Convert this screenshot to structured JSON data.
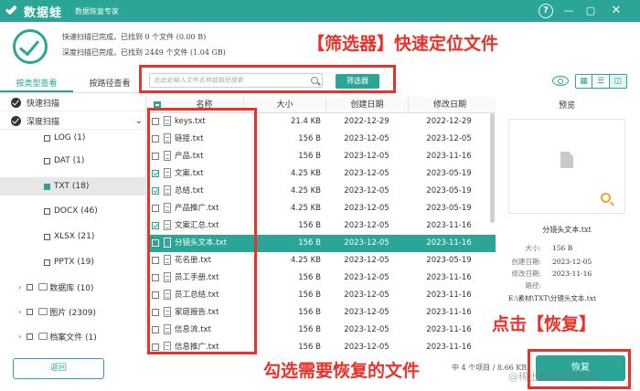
{
  "app": {
    "name": "数据蛙",
    "subtitle": "数据恢复专家",
    "window_controls": {
      "help": "?",
      "minimize": "—",
      "maximize": "▢",
      "close": "✕"
    }
  },
  "status": {
    "line1": "快速扫描已完成，已找到 0 个文件 (0.00  B)",
    "line2": "深度扫描已完成，已找到 2449 个文件 (1.04 GB)"
  },
  "annotations": {
    "filter": "【筛选器】快速定位文件",
    "select": "勾选需要恢复的文件",
    "click": "点击【恢复】"
  },
  "left_tabs": [
    {
      "label": "按类型查看",
      "active": true
    },
    {
      "label": "按路径查看",
      "active": false
    }
  ],
  "tree": {
    "quick_scan": "快速扫描",
    "deep_scan": "深度扫描",
    "types": [
      {
        "label": "LOG (1)",
        "selected": false
      },
      {
        "label": "DAT (1)",
        "selected": false
      },
      {
        "label": "TXT (18)",
        "selected": true
      },
      {
        "label": "DOCX (46)",
        "selected": false
      },
      {
        "label": "XLSX (21)",
        "selected": false
      },
      {
        "label": "PPTX (19)",
        "selected": false
      }
    ],
    "categories": [
      {
        "label": "数据库 (10)"
      },
      {
        "label": "图片 (2309)"
      },
      {
        "label": "档案文件 (1)"
      }
    ]
  },
  "back_button": "返回",
  "search": {
    "placeholder": "在此处输入文件名称或路径搜索",
    "filter_button": "筛选器"
  },
  "table": {
    "headers": {
      "name": "名称",
      "size": "大小",
      "created": "创建日期",
      "modified": "修改日期"
    },
    "rows": [
      {
        "name": "keys.txt",
        "size": "21.4 KB",
        "created": "2022-12-29",
        "modified": "2022-12-29",
        "checked": false,
        "selected": false
      },
      {
        "name": "链接.txt",
        "size": "156  B",
        "created": "2023-12-05",
        "modified": "2023-12-05",
        "checked": false,
        "selected": false
      },
      {
        "name": "产品.txt",
        "size": "156  B",
        "created": "2023-12-05",
        "modified": "2023-11-16",
        "checked": false,
        "selected": false
      },
      {
        "name": "文案.txt",
        "size": "4.25 KB",
        "created": "2023-12-05",
        "modified": "2023-05-19",
        "checked": true,
        "selected": false
      },
      {
        "name": "总结.txt",
        "size": "4.25 KB",
        "created": "2023-12-05",
        "modified": "2023-05-19",
        "checked": true,
        "selected": false
      },
      {
        "name": "产品推广.txt",
        "size": "4.25 KB",
        "created": "2023-12-05",
        "modified": "2023-05-19",
        "checked": false,
        "selected": false
      },
      {
        "name": "文案汇总.txt",
        "size": "156  B",
        "created": "2023-12-05",
        "modified": "2023-11-16",
        "checked": true,
        "selected": false
      },
      {
        "name": "分镜头文本.txt",
        "size": "156  B",
        "created": "2023-12-05",
        "modified": "2023-11-16",
        "checked": true,
        "selected": true
      },
      {
        "name": "花名册.txt",
        "size": "4.25 KB",
        "created": "2023-12-05",
        "modified": "2023-05-19",
        "checked": false,
        "selected": false
      },
      {
        "name": "员工手册.txt",
        "size": "156  B",
        "created": "2023-12-05",
        "modified": "2023-11-16",
        "checked": false,
        "selected": false
      },
      {
        "name": "员工总结.txt",
        "size": "156  B",
        "created": "2023-12-05",
        "modified": "2023-11-16",
        "checked": false,
        "selected": false
      },
      {
        "name": "家庭报告.txt",
        "size": "156  B",
        "created": "2023-12-05",
        "modified": "2023-11-16",
        "checked": false,
        "selected": false
      },
      {
        "name": "信息流.txt",
        "size": "156  B",
        "created": "2023-12-05",
        "modified": "2023-11-16",
        "checked": false,
        "selected": false
      },
      {
        "name": "信息推广.txt",
        "size": "156  B",
        "created": "2023-12-05",
        "modified": "2023-11-16",
        "checked": false,
        "selected": false
      }
    ]
  },
  "preview": {
    "title": "预览",
    "filename": "分镜头文本.txt",
    "meta": [
      {
        "key": "大小:",
        "value": "156  B"
      },
      {
        "key": "创建日期:",
        "value": "2023-12-05"
      },
      {
        "key": "修改日期:",
        "value": "2023-11-16"
      },
      {
        "key": "路径:",
        "value": ""
      }
    ],
    "path": "E:\\素材\\TXT\\分镜头文本.txt"
  },
  "bottom": {
    "status": "中 4 个项目 / 8.66 KB",
    "restore_button": "恢复",
    "watermark": "@稀土掘金技术社区"
  },
  "colors": {
    "accent": "#2aa596",
    "annotation": "#e8322a"
  }
}
